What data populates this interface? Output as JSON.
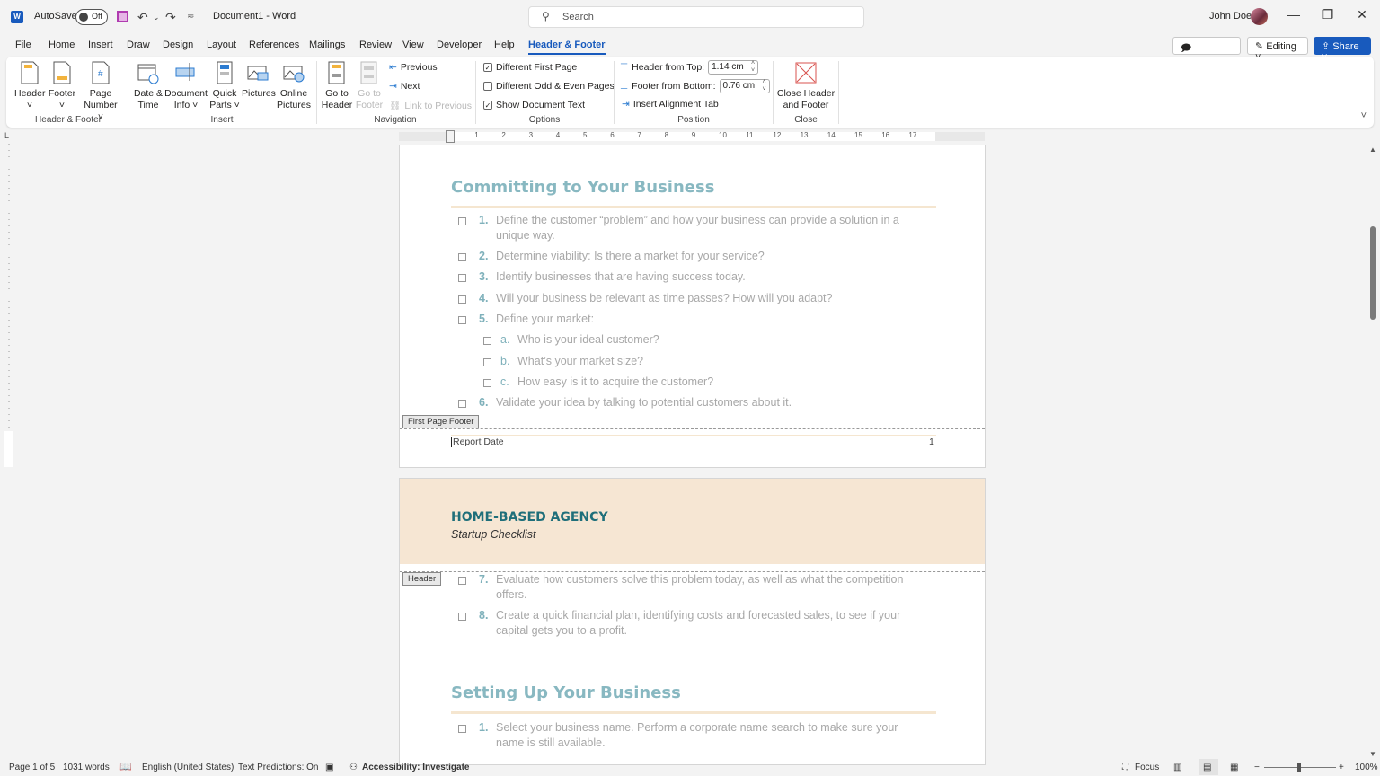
{
  "titlebar": {
    "app_icon": "word-icon",
    "autosave_label": "AutoSave",
    "autosave_state": "Off",
    "doc_title": "Document1  -  Word",
    "search_placeholder": "Search",
    "user_name": "John Doe"
  },
  "menu": {
    "tabs": [
      "File",
      "Home",
      "Insert",
      "Draw",
      "Design",
      "Layout",
      "References",
      "Mailings",
      "Review",
      "View",
      "Developer",
      "Help",
      "Header & Footer"
    ],
    "active": "Header & Footer",
    "comments": "Comments",
    "editing": "Editing",
    "share": "Share"
  },
  "ribbon": {
    "groups": {
      "header_footer": {
        "label": "Header & Footer",
        "header": "Header",
        "footer": "Footer",
        "page_number_1": "Page",
        "page_number_2": "Number"
      },
      "insert": {
        "label": "Insert",
        "date_1": "Date &",
        "date_2": "Time",
        "docinfo_1": "Document",
        "docinfo_2": "Info",
        "quick_1": "Quick",
        "quick_2": "Parts",
        "pictures": "Pictures",
        "online_1": "Online",
        "online_2": "Pictures"
      },
      "navigation": {
        "label": "Navigation",
        "goto_header_1": "Go to",
        "goto_header_2": "Header",
        "goto_footer_1": "Go to",
        "goto_footer_2": "Footer",
        "previous": "Previous",
        "next": "Next",
        "link_previous": "Link to Previous"
      },
      "options": {
        "label": "Options",
        "different_first_page": "Different First Page",
        "different_first_page_checked": true,
        "different_odd_even": "Different Odd & Even Pages",
        "different_odd_even_checked": false,
        "show_document_text": "Show Document Text",
        "show_document_text_checked": true
      },
      "position": {
        "label": "Position",
        "header_from_top": "Header from Top:",
        "header_from_top_value": "1.14 cm",
        "footer_from_bottom": "Footer from Bottom:",
        "footer_from_bottom_value": "0.76 cm",
        "insert_alignment_tab": "Insert Alignment Tab"
      },
      "close": {
        "label": "Close",
        "close_1": "Close Header",
        "close_2": "and Footer"
      }
    }
  },
  "ruler": {
    "ticks": [
      "1",
      "2",
      "3",
      "4",
      "5",
      "6",
      "7",
      "8",
      "9",
      "10",
      "11",
      "12",
      "13",
      "14",
      "15",
      "16",
      "17"
    ]
  },
  "document": {
    "page1": {
      "section_title": "Committing to Your Business",
      "items": [
        {
          "num": "1.",
          "text": "Define the customer “problem” and how your business can provide a solution in a",
          "text2": "unique way."
        },
        {
          "num": "2.",
          "text": "Determine viability: Is there a market for your service?"
        },
        {
          "num": "3.",
          "text": "Identify businesses that are having success today."
        },
        {
          "num": "4.",
          "text": "Will your business be relevant as time passes? How will you adapt?"
        },
        {
          "num": "5.",
          "text": "Define your market:"
        },
        {
          "num": "a.",
          "text": "Who is your ideal customer?"
        },
        {
          "num": "b.",
          "text": "What’s your market size?"
        },
        {
          "num": "c.",
          "text": "How easy is it to acquire the customer?"
        },
        {
          "num": "6.",
          "text": "Validate your idea by talking to potential customers about it."
        }
      ],
      "footer_tag": "First Page Footer",
      "footer_text": "Report Date",
      "page_number": "1"
    },
    "page2": {
      "header_title": "HOME-BASED AGENCY",
      "header_subtitle": "Startup Checklist",
      "header_tag": "Header",
      "items": [
        {
          "num": "7.",
          "text": "Evaluate how customers solve this problem today, as well as what the competition",
          "text2": "offers."
        },
        {
          "num": "8.",
          "text": "Create a quick financial plan, identifying costs and forecasted sales, to see if your",
          "text2": "capital gets you to a profit."
        }
      ],
      "section_title": "Setting Up Your Business",
      "items2": [
        {
          "num": "1.",
          "text": "Select your business name. Perform a corporate name search to make sure your",
          "text2": "name is still available."
        }
      ]
    }
  },
  "statusbar": {
    "page": "Page 1 of 5",
    "words": "1031 words",
    "language": "English (United States)",
    "text_predictions": "Text Predictions: On",
    "accessibility": "Accessibility: Investigate",
    "focus": "Focus",
    "zoom": "100%",
    "zoom_percent": 100
  },
  "colors": {
    "accent": "#185abd",
    "heading": "#88b8c1",
    "header_band": "#f6e6d3",
    "agency_title": "#1f6f7a"
  }
}
